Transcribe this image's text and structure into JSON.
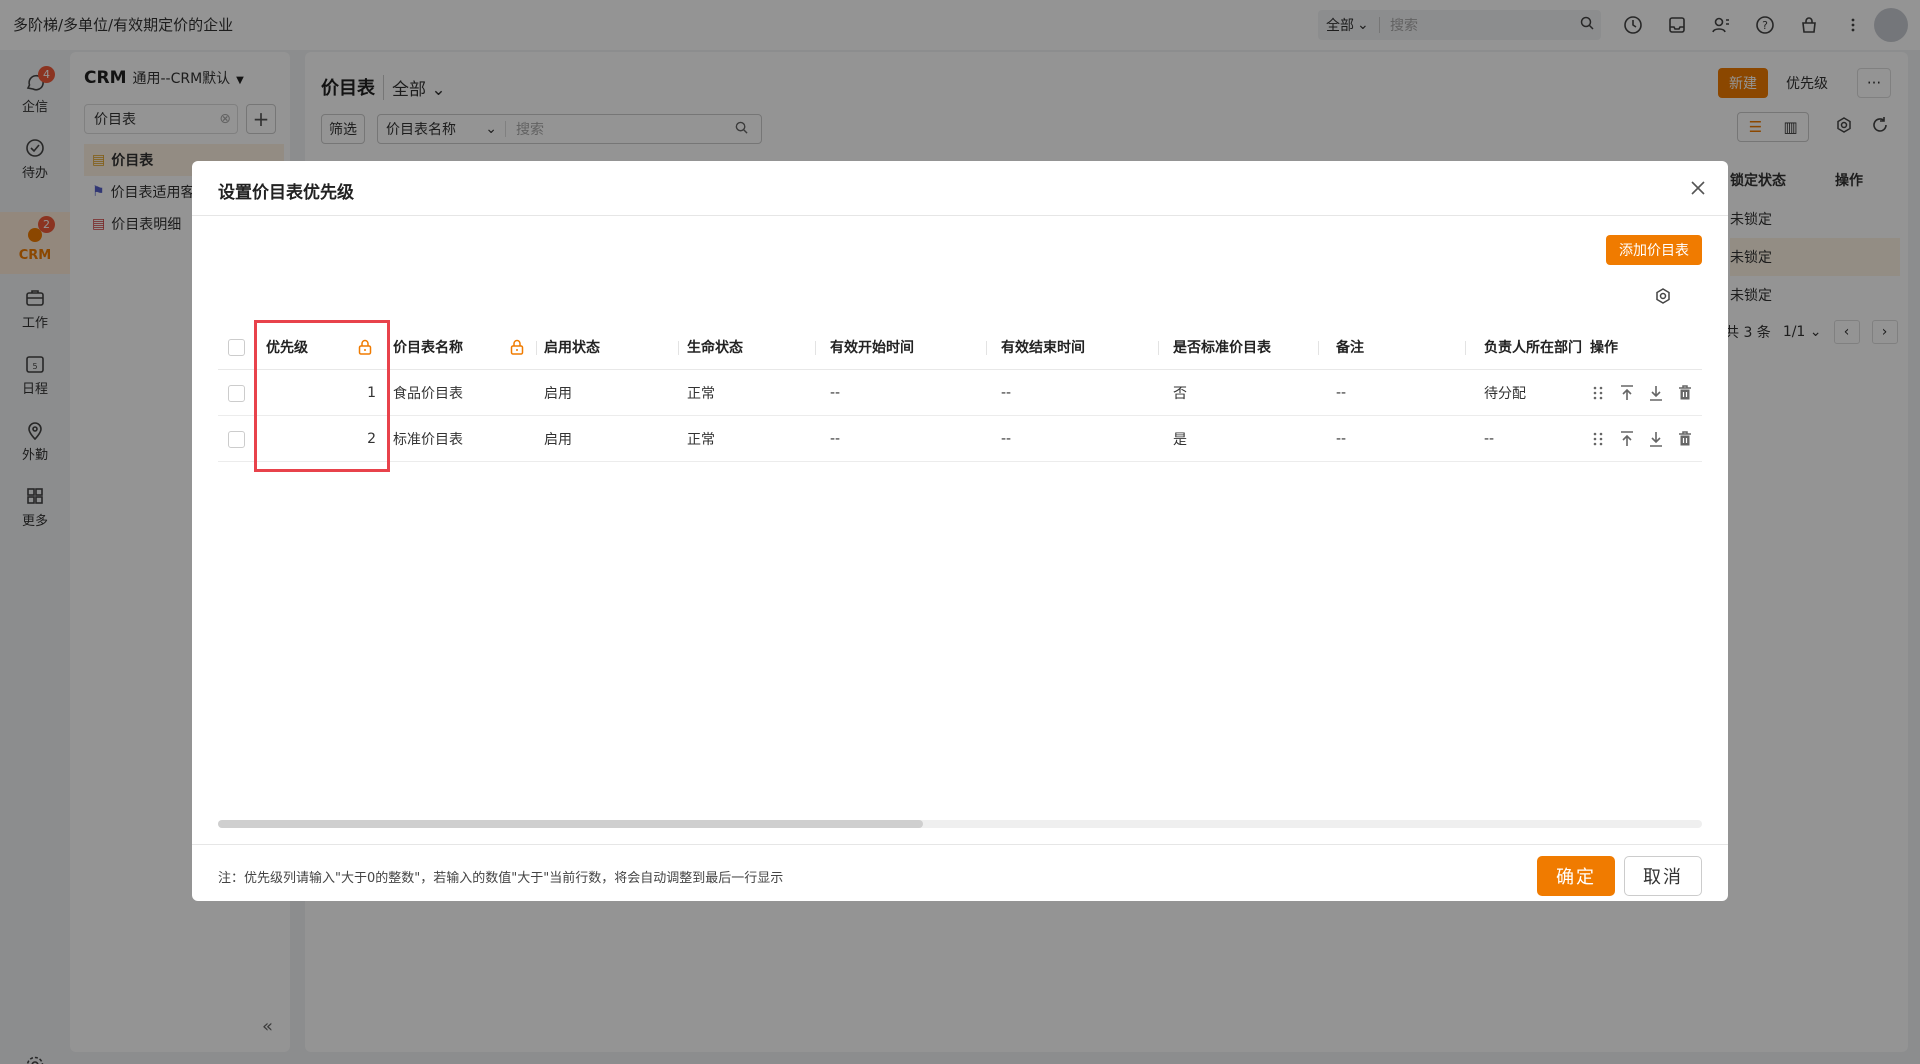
{
  "app": {
    "title": "多阶梯/多单位/有效期定价的企业",
    "search_scope": "全部",
    "search_placeholder": "搜索"
  },
  "nav": [
    {
      "label": "企信",
      "icon": "chat-icon",
      "badge": "4"
    },
    {
      "label": "待办",
      "icon": "check-circle-icon",
      "badge": ""
    },
    {
      "label": "CRM",
      "icon": "crm-icon",
      "badge": "2"
    },
    {
      "label": "工作",
      "icon": "briefcase-icon",
      "badge": ""
    },
    {
      "label": "日程",
      "icon": "calendar-icon",
      "badge": ""
    },
    {
      "label": "外勤",
      "icon": "location-pin-icon",
      "badge": ""
    },
    {
      "label": "更多",
      "icon": "grid-icon",
      "badge": ""
    }
  ],
  "sidepanel": {
    "title": "CRM",
    "subtitle": "通用--CRM默认",
    "search_value": "价目表",
    "items": [
      {
        "label": "价目表"
      },
      {
        "label": "价目表适用客"
      },
      {
        "label": "价目表明细"
      }
    ]
  },
  "main": {
    "title": "价目表",
    "scope": "全部",
    "filter_label": "筛选",
    "search_field": "价目表名称",
    "search_placeholder": "搜索",
    "new_label": "新建",
    "priority_label": "优先级",
    "col_lock": "锁定状态",
    "col_ops": "操作",
    "rows": [
      "未锁定",
      "未锁定",
      "未锁定"
    ],
    "total": "共 3 条",
    "page": "1/1"
  },
  "modal": {
    "title": "设置价目表优先级",
    "add_label": "添加价目表",
    "columns": [
      "优先级",
      "价目表名称",
      "启用状态",
      "生命状态",
      "有效开始时间",
      "有效结束时间",
      "是否标准价目表",
      "备注",
      "负责人所在部门",
      "操作"
    ],
    "rows": [
      {
        "priority": "1",
        "name": "食品价目表",
        "enabled": "启用",
        "life": "正常",
        "start": "--",
        "end": "--",
        "standard": "否",
        "remark": "--",
        "dept": "待分配"
      },
      {
        "priority": "2",
        "name": "标准价目表",
        "enabled": "启用",
        "life": "正常",
        "start": "--",
        "end": "--",
        "standard": "是",
        "remark": "--",
        "dept": "--"
      }
    ],
    "note": "注：优先级列请输入\"大于0的整数\"，若输入的数值\"大于\"当前行数，将会自动调整到最后一行显示",
    "ok_label": "确定",
    "cancel_label": "取消"
  },
  "colors": {
    "accent": "#f07b00",
    "highlight": "#e8424b"
  }
}
